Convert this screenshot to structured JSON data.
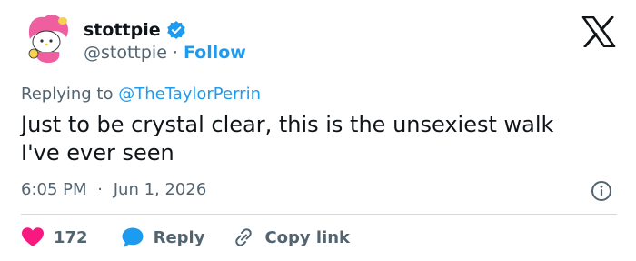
{
  "author": {
    "display_name": "stottpie",
    "handle": "@stottpie",
    "separator": "·",
    "follow_label": "Follow"
  },
  "reply_context": {
    "prefix": "Replying to",
    "mention": "@TheTaylorPerrin"
  },
  "tweet": {
    "text": "Just to be crystal clear, this is the unsexiest walk\nI've ever seen",
    "time": "6:05 PM",
    "separator": "·",
    "date": "Jun 1, 2026"
  },
  "actions": {
    "like_count": "172",
    "reply_label": "Reply",
    "copy_label": "Copy link"
  },
  "icons": {
    "avatar": "my-melody-avatar",
    "verified": "verified-badge-icon",
    "logo": "x-logo-icon",
    "info": "info-icon",
    "like": "heart-icon",
    "reply": "speech-bubble-icon",
    "copy": "link-icon"
  },
  "colors": {
    "accent": "#1d9bf0",
    "like": "#f91880",
    "text": "#0f1419",
    "secondary": "#536471"
  }
}
